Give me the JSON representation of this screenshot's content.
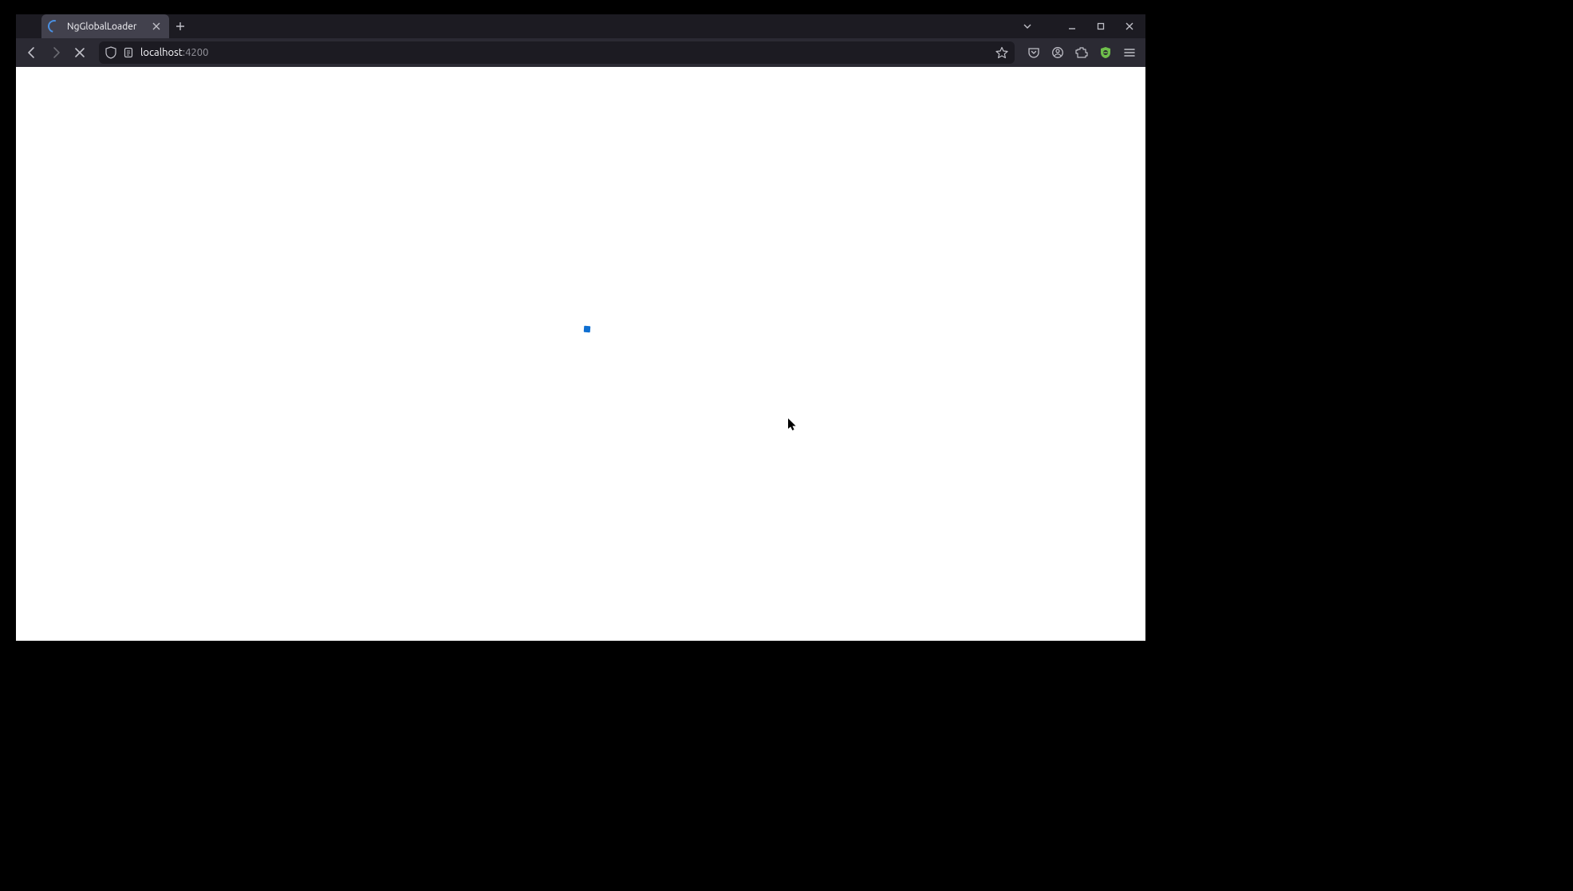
{
  "tab": {
    "title": "NgGlobalLoader"
  },
  "address": {
    "host": "localhost",
    "port": ":4200"
  },
  "colors": {
    "accent": "#0f6fd1"
  }
}
